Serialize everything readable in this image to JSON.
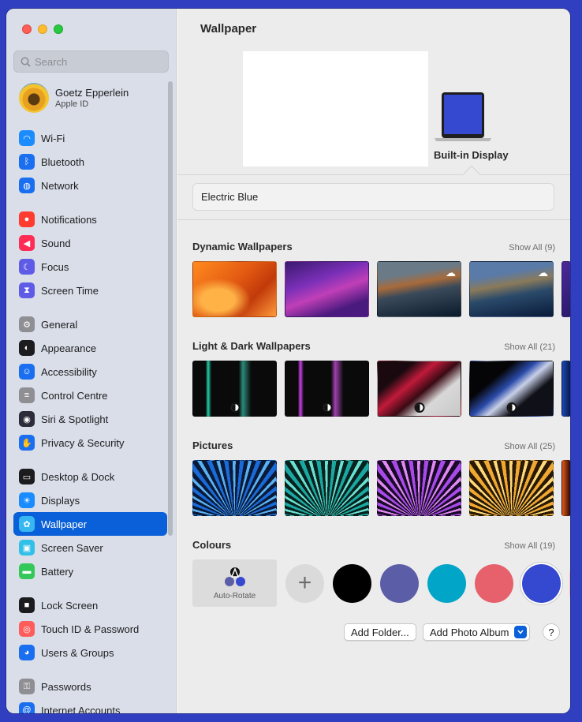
{
  "window": {
    "title": "Wallpaper"
  },
  "sidebar": {
    "search_placeholder": "Search",
    "profile": {
      "name": "Goetz Epperlein",
      "subtitle": "Apple ID"
    },
    "groups": [
      [
        {
          "label": "Wi-Fi",
          "icon": "wifi-icon",
          "color": "#1a8cff"
        },
        {
          "label": "Bluetooth",
          "icon": "bluetooth-icon",
          "color": "#1a6ff0"
        },
        {
          "label": "Network",
          "icon": "globe-icon",
          "color": "#1a6ff0"
        }
      ],
      [
        {
          "label": "Notifications",
          "icon": "bell-icon",
          "color": "#ff3b30"
        },
        {
          "label": "Sound",
          "icon": "speaker-icon",
          "color": "#ff2d55"
        },
        {
          "label": "Focus",
          "icon": "moon-icon",
          "color": "#5e5ce6"
        },
        {
          "label": "Screen Time",
          "icon": "hourglass-icon",
          "color": "#5e5ce6"
        }
      ],
      [
        {
          "label": "General",
          "icon": "gear-icon",
          "color": "#8e8e93"
        },
        {
          "label": "Appearance",
          "icon": "appearance-icon",
          "color": "#1c1c1e"
        },
        {
          "label": "Accessibility",
          "icon": "accessibility-icon",
          "color": "#1a6ff0"
        },
        {
          "label": "Control Centre",
          "icon": "control-centre-icon",
          "color": "#8e8e93"
        },
        {
          "label": "Siri & Spotlight",
          "icon": "siri-icon",
          "color": "#2c2c3a"
        },
        {
          "label": "Privacy & Security",
          "icon": "hand-icon",
          "color": "#1a6ff0"
        }
      ],
      [
        {
          "label": "Desktop & Dock",
          "icon": "dock-icon",
          "color": "#1c1c1e"
        },
        {
          "label": "Displays",
          "icon": "sun-icon",
          "color": "#1a8cff"
        },
        {
          "label": "Wallpaper",
          "icon": "wallpaper-icon",
          "color": "#36b7f0",
          "active": true
        },
        {
          "label": "Screen Saver",
          "icon": "screensaver-icon",
          "color": "#30c0e8"
        },
        {
          "label": "Battery",
          "icon": "battery-icon",
          "color": "#34c759"
        }
      ],
      [
        {
          "label": "Lock Screen",
          "icon": "lock-icon",
          "color": "#1c1c1e"
        },
        {
          "label": "Touch ID & Password",
          "icon": "fingerprint-icon",
          "color": "#ff5c5c"
        },
        {
          "label": "Users & Groups",
          "icon": "users-icon",
          "color": "#1a6ff0"
        }
      ],
      [
        {
          "label": "Passwords",
          "icon": "key-icon",
          "color": "#8e8e93"
        },
        {
          "label": "Internet Accounts",
          "icon": "at-icon",
          "color": "#1a6ff0"
        }
      ]
    ]
  },
  "main": {
    "title": "Wallpaper",
    "display_label": "Built-in Display",
    "wallpaper_name": "Electric Blue",
    "sections": [
      {
        "title": "Dynamic Wallpapers",
        "show_all": "Show All (9)"
      },
      {
        "title": "Light & Dark Wallpapers",
        "show_all": "Show All (21)"
      },
      {
        "title": "Pictures",
        "show_all": "Show All (25)"
      },
      {
        "title": "Colours",
        "show_all": "Show All (19)"
      }
    ],
    "auto_rotate_label": "Auto-Rotate",
    "colours": [
      "#000000",
      "#5b5ea6",
      "#00a5c8",
      "#e6616c",
      "#3548d0"
    ],
    "buttons": {
      "add_folder": "Add Folder...",
      "add_album": "Add Photo Album",
      "help": "?"
    }
  }
}
